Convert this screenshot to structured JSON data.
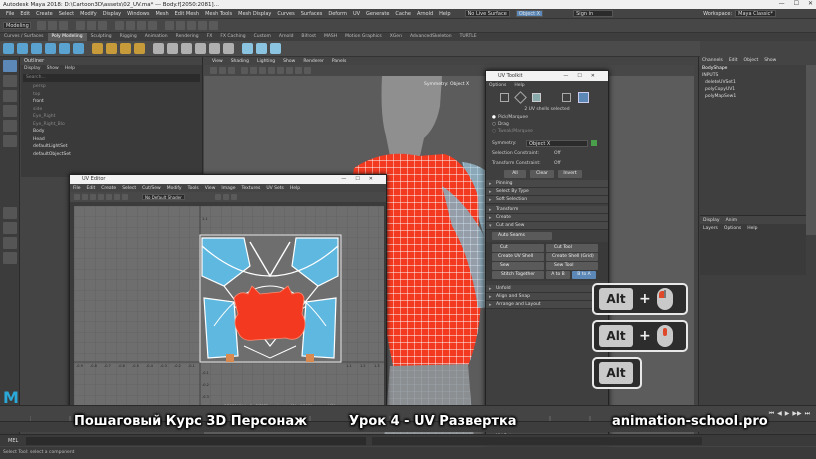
{
  "window": {
    "title": "Autodesk Maya 2018: D:\\Cartoon3D\\assets\\02_UV.ma*  ---  Body.f[2050:2081]..."
  },
  "menubar": {
    "items": [
      "File",
      "Edit",
      "Create",
      "Select",
      "Modify",
      "Display",
      "Windows",
      "Mesh",
      "Edit Mesh",
      "Mesh Tools",
      "Mesh Display",
      "Curves",
      "Surfaces",
      "Deform",
      "UV",
      "Generate",
      "Cache",
      "Arnold",
      "Help"
    ],
    "live_surface": "No Live Surface",
    "symmetry": "Object X",
    "sign_in": "Sign in",
    "workspace_label": "Workspace:",
    "workspace_value": "Maya Classic*"
  },
  "statusline": {
    "mode": "Modeling"
  },
  "shelf_tabs": [
    "Curves / Surfaces",
    "Poly Modeling",
    "Sculpting",
    "Rigging",
    "Animation",
    "Rendering",
    "FX",
    "FX Caching",
    "Custom",
    "Arnold",
    "Bifrost",
    "MASH",
    "Motion Graphics",
    "XGen",
    "AdvancedSkeleton",
    "TURTLE"
  ],
  "shelf_active_tab": "Poly Modeling",
  "outliner": {
    "title": "Outliner",
    "menu": [
      "Display",
      "Show",
      "Help"
    ],
    "search_placeholder": "Search...",
    "items": [
      {
        "name": "persp",
        "visible": false
      },
      {
        "name": "top",
        "visible": false
      },
      {
        "name": "front",
        "visible": true
      },
      {
        "name": "side",
        "visible": false
      },
      {
        "name": "Eye_Right",
        "visible": false
      },
      {
        "name": "Eye_Right_Blo",
        "visible": false
      },
      {
        "name": "Body",
        "visible": true
      },
      {
        "name": "Head",
        "visible": true
      },
      {
        "name": "defaultLightSet",
        "visible": true
      },
      {
        "name": "defaultObjectSet",
        "visible": true
      }
    ]
  },
  "viewport": {
    "menu": [
      "View",
      "Shading",
      "Lighting",
      "Show",
      "Renderer",
      "Panels"
    ],
    "camera_label": "Symmetry: Object X"
  },
  "channelbox": {
    "tabs": [
      "Channels",
      "Edit",
      "Object",
      "Show"
    ],
    "lines": [
      "BodyShape",
      "INPUTS",
      "deleteUVSet1",
      "polyCopyUV1",
      "polyMapSew1"
    ],
    "layer_tabs": [
      "Display",
      "Anim"
    ],
    "layer_menu": [
      "Layers",
      "Options",
      "Help"
    ]
  },
  "uveditor": {
    "title": "UV Editor",
    "menu": [
      "File",
      "Edit",
      "Create",
      "Select",
      "Cut/Sew",
      "Modify",
      "Tools",
      "View",
      "Image",
      "Textures",
      "UV Sets",
      "Help"
    ],
    "default_shader": "No Default Shader",
    "status": "0/1930 UV shells, 0/3930 overlapping UVs, 0/1930 reversed UVs",
    "axis_labels": {
      "x": [
        "-0.9",
        "-0.8",
        "-0.7",
        "-0.6",
        "-0.5",
        "-0.4",
        "-0.3",
        "-0.2",
        "-0.1",
        "1.1",
        "1.2",
        "1.3"
      ],
      "y": [
        "1.1",
        "-0.1",
        "-0.2",
        "-0.3"
      ]
    }
  },
  "uvtoolkit": {
    "title": "UV Toolkit",
    "menu": [
      "Options",
      "Help"
    ],
    "selected_info": "2 UV shells selected",
    "select_modes": [
      "Pick/Marquee",
      "Drag",
      "Tweak/Marquee"
    ],
    "symmetry_label": "Symmetry:",
    "symmetry_value": "Object X",
    "selection_constraint_label": "Selection Constraint:",
    "selection_constraint_value": "Off",
    "transform_constraint_label": "Transform Constraint:",
    "transform_constraint_value": "Off",
    "all_button": "All",
    "clear_button": "Clear",
    "invert_button": "Invert",
    "sections": [
      "Pinning",
      "Select By Type",
      "Soft Selection",
      "Transform",
      "Create",
      "Cut and Sew"
    ],
    "auto_seams": "Auto Seams",
    "cut_button": "Cut",
    "cut_tool_button": "Cut Tool",
    "create_uv_shell_button": "Create UV Shell",
    "create_shell_grid_button": "Create Shell (Grid)",
    "sew_button": "Sew",
    "sew_tool_button": "Sew Tool",
    "stitch_together_button": "Stitch Together",
    "a_to_b": "A to B",
    "b_to_a": "B to A",
    "sections_after": [
      "Unfold",
      "Align and Snap",
      "Arrange and Layout"
    ],
    "uv_sets": "UV Sets"
  },
  "keyhints": [
    {
      "key": "Alt",
      "mouse": "left-mouse-icon"
    },
    {
      "key": "Alt",
      "mouse": "middle-mouse-icon"
    },
    {
      "key": "Alt",
      "mouse": ""
    }
  ],
  "captions": {
    "left": "Пошаговый Курс 3D Персонаж",
    "center": "Урок 4 - UV Развертка",
    "right": "animation-school.pro"
  },
  "bottom": {
    "cmd_label": "MEL",
    "help_text": "Select Tool: select a component"
  },
  "colors": {
    "accent": "#5c88b8",
    "shirt_selection": "#f33a20",
    "uv_shell": "#5fb8e0",
    "maya_logo": "#2aa8d8"
  }
}
